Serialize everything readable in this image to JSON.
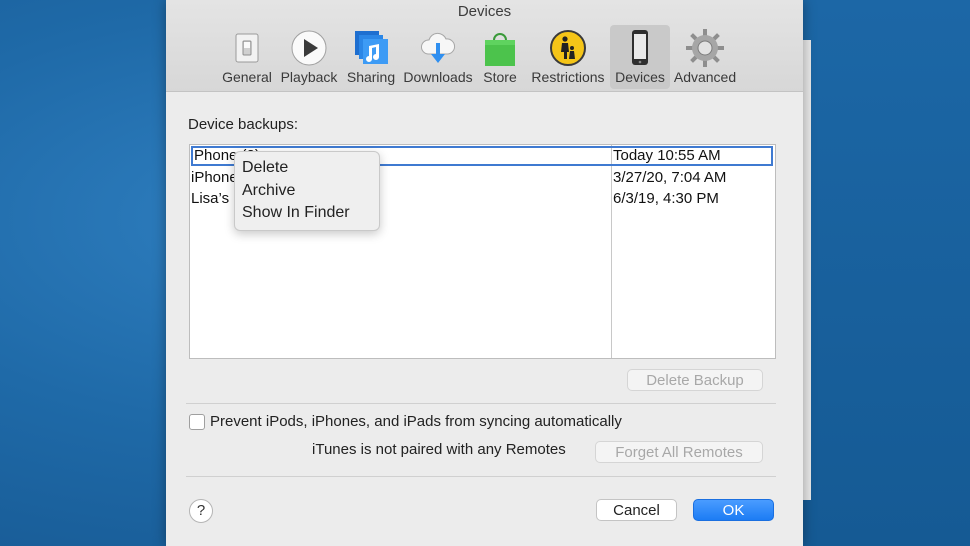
{
  "window": {
    "title": "Devices"
  },
  "toolbar": {
    "items": [
      {
        "label": "General",
        "icon": "general-switch-icon"
      },
      {
        "label": "Playback",
        "icon": "play-icon"
      },
      {
        "label": "Sharing",
        "icon": "music-note-icon"
      },
      {
        "label": "Downloads",
        "icon": "cloud-download-icon"
      },
      {
        "label": "Store",
        "icon": "shopping-bag-icon"
      },
      {
        "label": "Restrictions",
        "icon": "parental-icon"
      },
      {
        "label": "Devices",
        "icon": "iphone-icon",
        "selected": true
      },
      {
        "label": "Advanced",
        "icon": "gear-icon"
      }
    ]
  },
  "main": {
    "section_label": "Device backups:",
    "backups": [
      {
        "name": "Phone (2)",
        "date": "Today 10:55 AM",
        "selected": true
      },
      {
        "name": "iPhone",
        "date": "3/27/20, 7:04 AM"
      },
      {
        "name": "Lisa’s",
        "date": "6/3/19, 4:30 PM"
      }
    ],
    "context_menu": [
      "Delete",
      "Archive",
      "Show In Finder"
    ],
    "delete_backup_label": "Delete Backup",
    "prevent_sync_label": "Prevent iPods, iPhones, and iPads from syncing automatically",
    "remotes_status": "iTunes is not paired with any Remotes",
    "forget_remotes_label": "Forget All Remotes"
  },
  "footer": {
    "help_label": "?",
    "cancel_label": "Cancel",
    "ok_label": "OK"
  },
  "colors": {
    "accent": "#1c7cf4",
    "selection_border": "#3f7ad1",
    "desktop": "#1f6aa8"
  }
}
